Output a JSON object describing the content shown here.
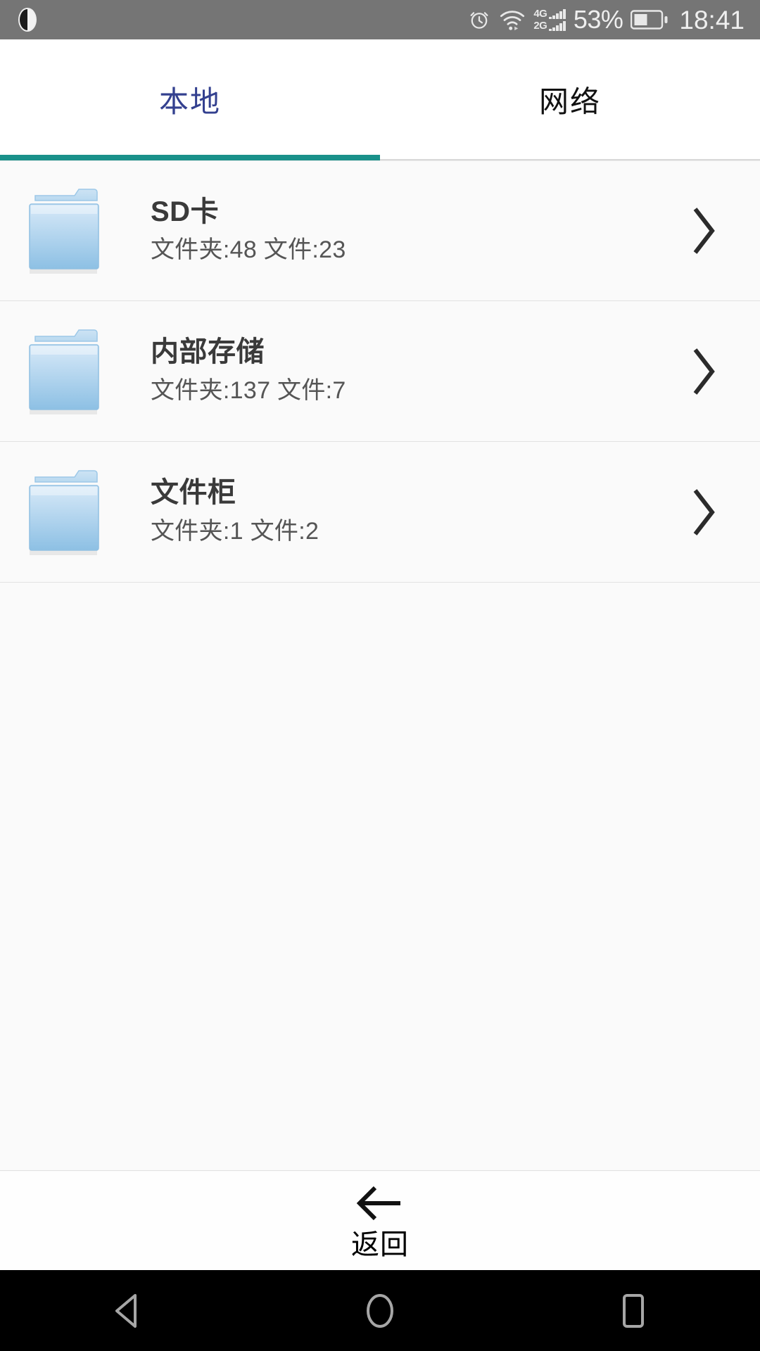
{
  "statusbar": {
    "theme_icon": "half-moon-icon",
    "alarm_icon": "alarm-clock-icon",
    "wifi_icon": "wifi-icon",
    "signal_4g_label": "4G",
    "signal_2g_label": "2G",
    "battery_percent": "53%",
    "battery_icon": "battery-icon",
    "time": "18:41",
    "background_color": "#757575",
    "foreground_color": "#e8e8e8"
  },
  "tabs": {
    "active_index": 0,
    "active_color": "#33408f",
    "indicator_color": "#19918a",
    "items": [
      {
        "label": "本地"
      },
      {
        "label": "网络"
      }
    ]
  },
  "list": {
    "items": [
      {
        "icon": "folder-icon",
        "title": "SD卡",
        "subtitle": "文件夹:48 文件:23",
        "chevron": "chevron-right-icon"
      },
      {
        "icon": "folder-icon",
        "title": "内部存储",
        "subtitle": "文件夹:137 文件:7",
        "chevron": "chevron-right-icon"
      },
      {
        "icon": "folder-icon",
        "title": "文件柜",
        "subtitle": "文件夹:1 文件:2",
        "chevron": "chevron-right-icon"
      }
    ]
  },
  "bottom_bar": {
    "back_icon": "arrow-left-icon",
    "back_label": "返回"
  },
  "navbar": {
    "back_icon": "triangle-back-icon",
    "home_icon": "circle-home-icon",
    "recents_icon": "square-recents-icon",
    "background_color": "#000000",
    "icon_color": "#a6a6a6"
  },
  "colors": {
    "list_background": "#fafafa",
    "divider": "#e2e2e2",
    "title_text": "#3a3a3a",
    "subtitle_text": "#555555",
    "folder_blue_light": "#cfe4f5",
    "folder_blue_dark": "#74b3de"
  }
}
